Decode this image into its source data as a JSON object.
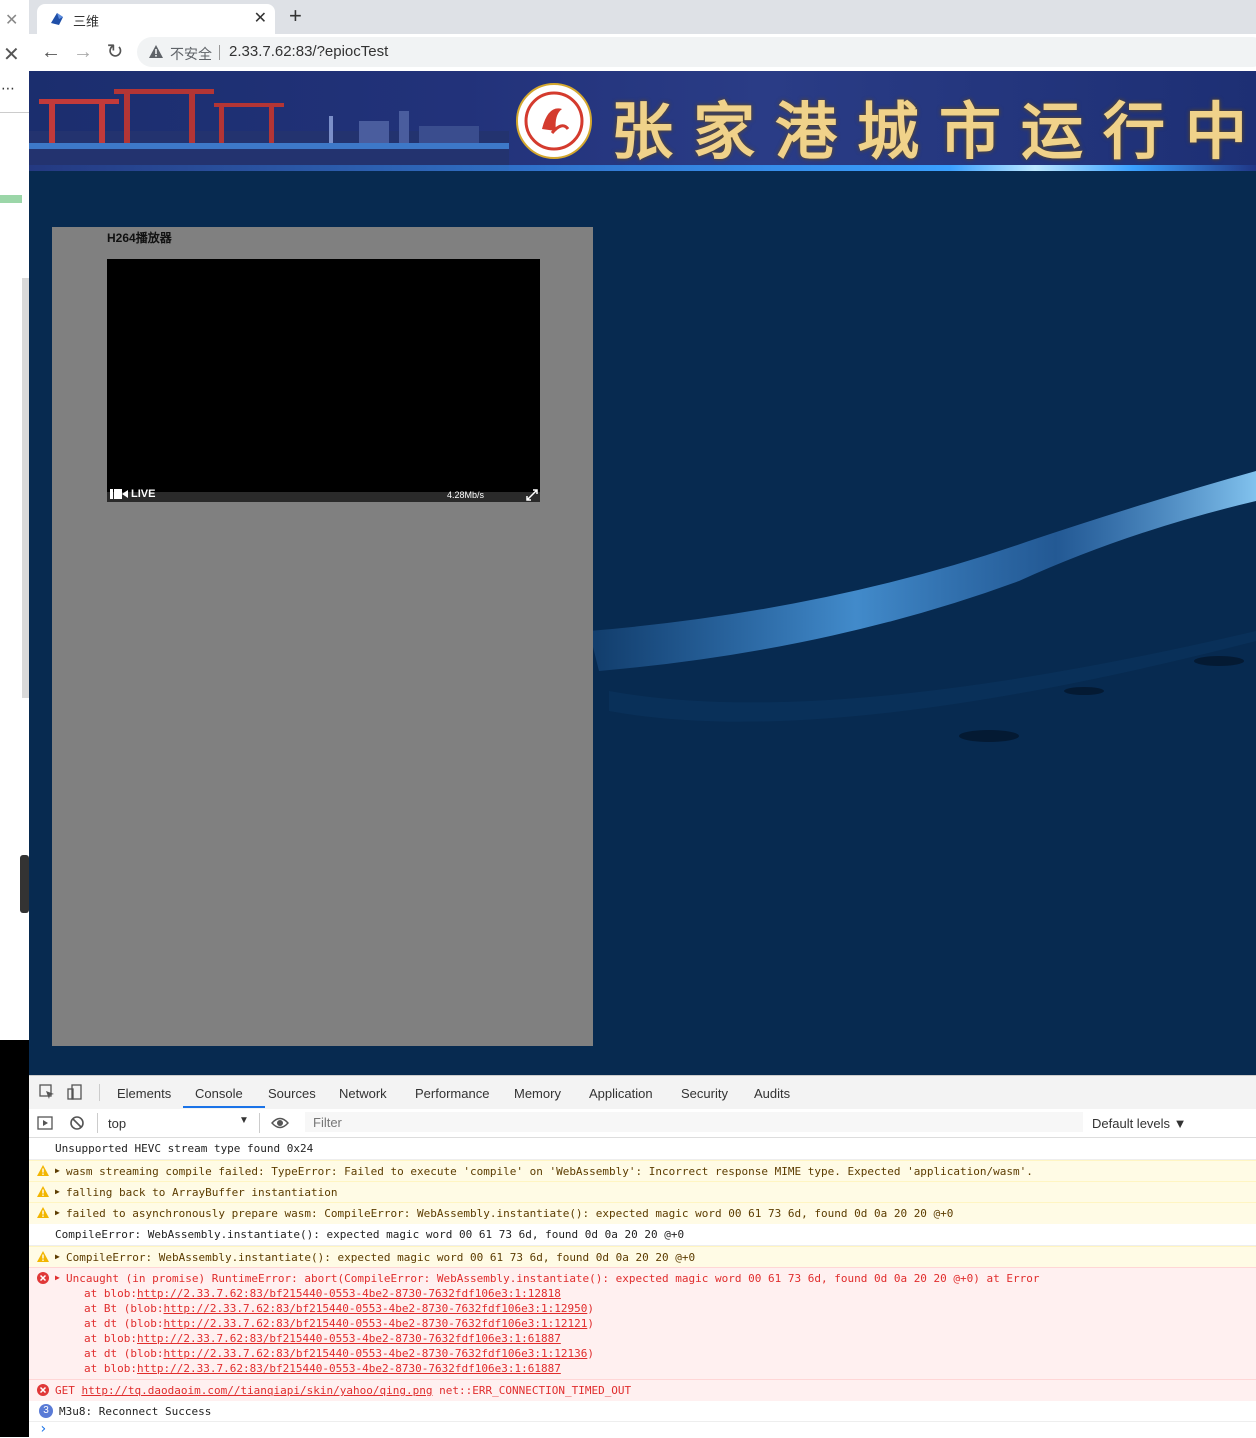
{
  "browser": {
    "tab_title": "三维",
    "security_label": "不安全",
    "url": "2.33.7.62:83/?epiocTest"
  },
  "page": {
    "banner_title": "张家港城市运行中",
    "player_title": "H264播放器",
    "live_label": "LIVE",
    "rate_label": "4.28Mb/s"
  },
  "devtools": {
    "tabs": [
      "Elements",
      "Console",
      "Sources",
      "Network",
      "Performance",
      "Memory",
      "Application",
      "Security",
      "Audits"
    ],
    "active_tab": "Console",
    "context": "top",
    "filter_placeholder": "Filter",
    "levels": "Default levels ▼",
    "messages": [
      {
        "type": "log",
        "text": "Unsupported HEVC stream type found 0x24"
      },
      {
        "type": "warning",
        "text": "wasm streaming compile failed: TypeError: Failed to execute 'compile' on 'WebAssembly': Incorrect response MIME type. Expected 'application/wasm'."
      },
      {
        "type": "warning",
        "text": "falling back to ArrayBuffer instantiation"
      },
      {
        "type": "warning",
        "text": "failed to asynchronously prepare wasm: CompileError: WebAssembly.instantiate(): expected magic word 00 61 73 6d, found 0d 0a 20 20 @+0"
      },
      {
        "type": "log",
        "text": "CompileError: WebAssembly.instantiate(): expected magic word 00 61 73 6d, found 0d 0a 20 20 @+0"
      },
      {
        "type": "warning",
        "text": "CompileError: WebAssembly.instantiate(): expected magic word 00 61 73 6d, found 0d 0a 20 20 @+0"
      },
      {
        "type": "error",
        "text": "Uncaught (in promise) RuntimeError: abort(CompileError: WebAssembly.instantiate(): expected magic word 00 61 73 6d, found 0d 0a 20 20 @+0) at Error"
      },
      {
        "type": "error",
        "text": "GET http://tq.daodaoim.com//tianqiapi/skin/yahoo/qing.png net::ERR_CONNECTION_TIMED_OUT"
      },
      {
        "type": "info",
        "text": "M3u8: Reconnect Success",
        "count": "3"
      }
    ],
    "stack": [
      {
        "prefix": "at blob:",
        "link": "http://2.33.7.62:83/bf215440-0553-4be2-8730-7632fdf106e3:1:12818",
        "suffix": ""
      },
      {
        "prefix": "at Bt (blob:",
        "link": "http://2.33.7.62:83/bf215440-0553-4be2-8730-7632fdf106e3:1:12950",
        "suffix": ")"
      },
      {
        "prefix": "at dt (blob:",
        "link": "http://2.33.7.62:83/bf215440-0553-4be2-8730-7632fdf106e3:1:12121",
        "suffix": ")"
      },
      {
        "prefix": "at blob:",
        "link": "http://2.33.7.62:83/bf215440-0553-4be2-8730-7632fdf106e3:1:61887",
        "suffix": ""
      },
      {
        "prefix": "at dt (blob:",
        "link": "http://2.33.7.62:83/bf215440-0553-4be2-8730-7632fdf106e3:1:12136",
        "suffix": ")"
      },
      {
        "prefix": "at blob:",
        "link": "http://2.33.7.62:83/bf215440-0553-4be2-8730-7632fdf106e3:1:61887",
        "suffix": ""
      }
    ],
    "get_method": "GET",
    "get_url": "http://tq.daodaoim.com//tianqiapi/skin/yahoo/qing.png",
    "get_error": "net::ERR_CONNECTION_TIMED_OUT",
    "prompt": "›"
  }
}
